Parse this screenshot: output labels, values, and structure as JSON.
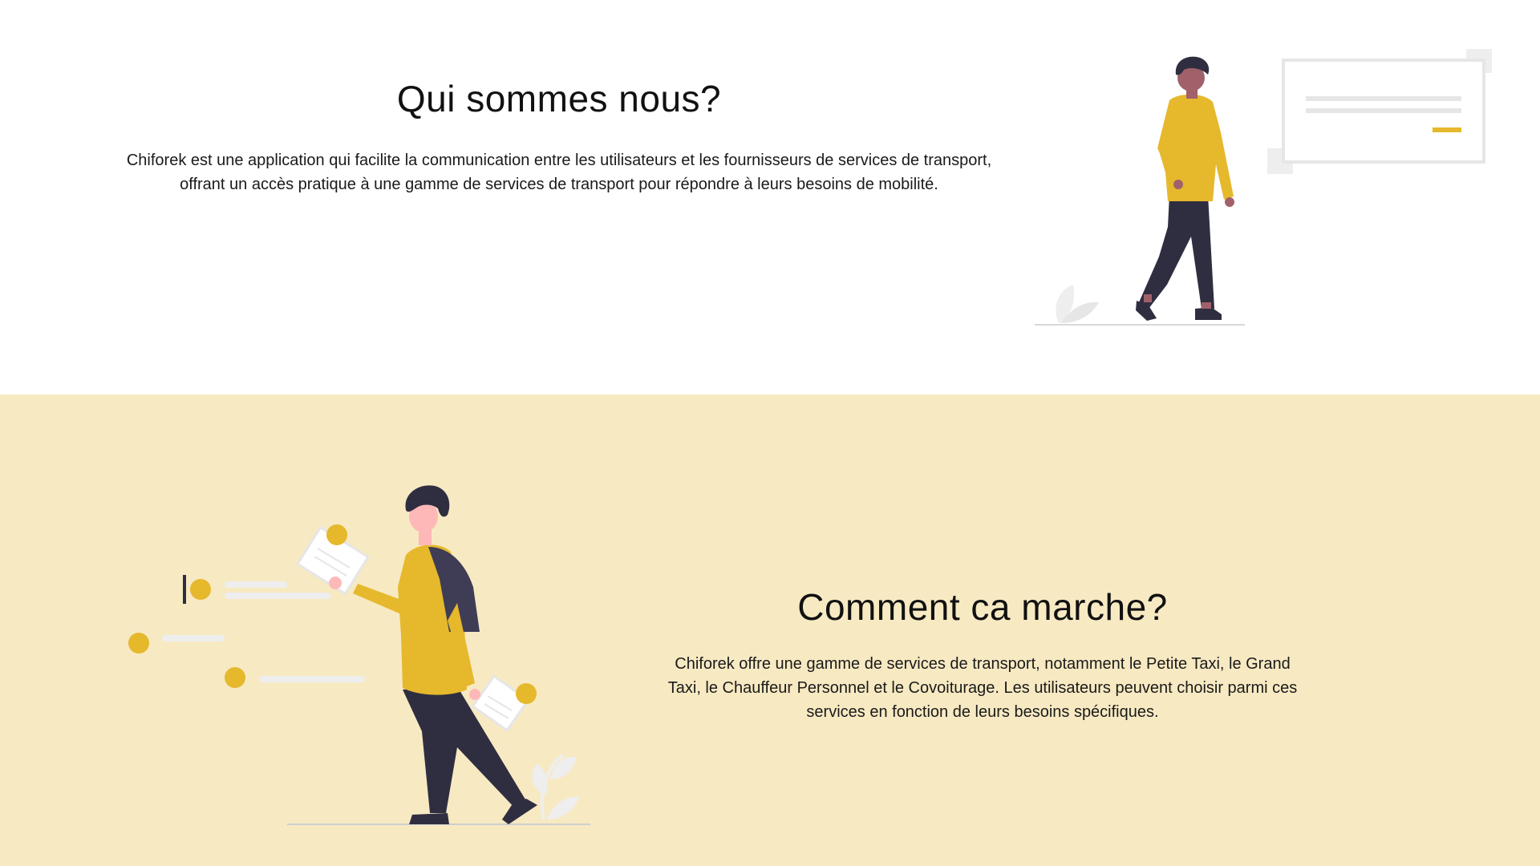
{
  "about": {
    "title": "Qui sommes nous?",
    "description": "Chiforek est une application qui facilite la communication entre les utilisateurs et les fournisseurs de services de transport, offrant un accès pratique à une gamme de services de transport pour répondre à leurs besoins de mobilité."
  },
  "how_it_works": {
    "title": "Comment ca marche?",
    "description": "Chiforek offre une gamme de services de transport, notamment le Petite Taxi, le Grand Taxi, le Chauffeur Personnel et le Covoiturage. Les utilisateurs peuvent choisir parmi ces services en fonction de leurs besoins spécifiques."
  },
  "colors": {
    "accent_yellow": "#e6b82c",
    "section_background": "#f7e9c2",
    "dark_navy": "#2f2e41",
    "light_gray": "#e6e6e6"
  },
  "illustrations": {
    "about": "person-walking-with-card-illustration",
    "how_it_works": "person-reading-documents-illustration"
  }
}
